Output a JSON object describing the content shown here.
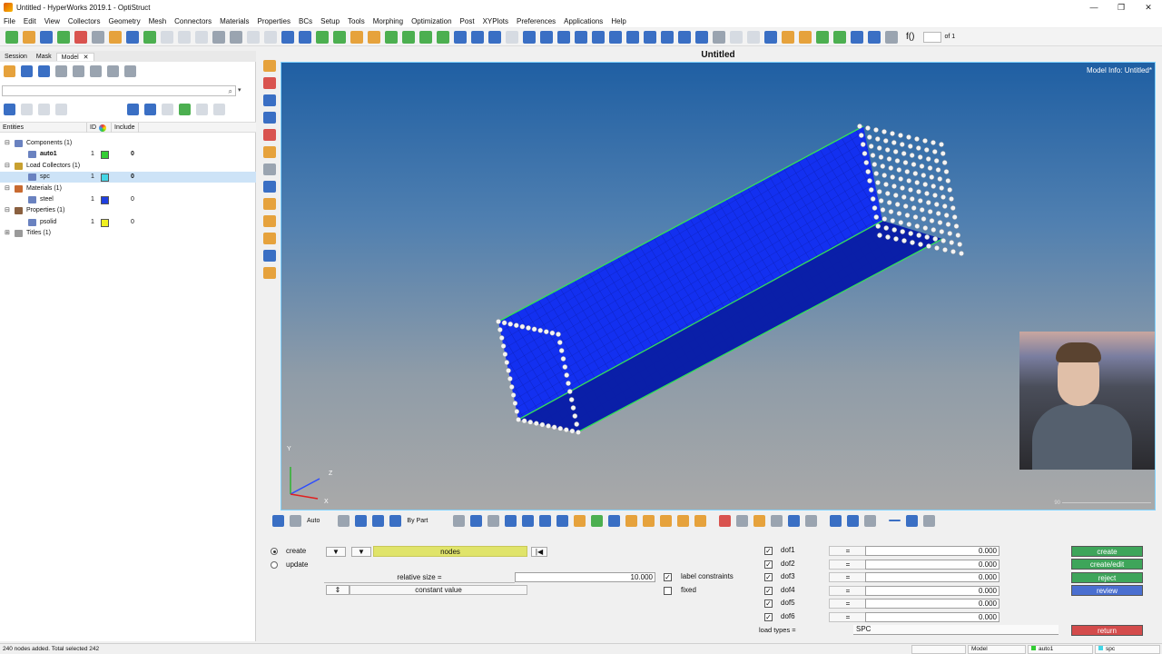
{
  "window": {
    "title": "Untitled - HyperWorks 2019.1 - OptiStruct",
    "controls": [
      "—",
      "❐",
      "✕"
    ]
  },
  "menu": [
    "File",
    "Edit",
    "View",
    "Collectors",
    "Geometry",
    "Mesh",
    "Connectors",
    "Materials",
    "Properties",
    "BCs",
    "Setup",
    "Tools",
    "Morphing",
    "Optimization",
    "Post",
    "XYPlots",
    "Preferences",
    "Applications",
    "Help"
  ],
  "toolbar": {
    "formula_label": "f()",
    "page_label": "of 1"
  },
  "left_panel": {
    "tabs": [
      "Session",
      "Mask",
      "Model"
    ],
    "close_glyph": "✕",
    "search_dropdown": "▾",
    "columns": {
      "entities": "Entities",
      "id": "ID",
      "include": "Include"
    },
    "tree": [
      {
        "name": "Components (1)",
        "level": 0,
        "expand": "⊟",
        "icon": "#6a82c0"
      },
      {
        "name": "auto1",
        "level": 1,
        "id": "1",
        "color": "#33cc33",
        "include": "0",
        "bold": true
      },
      {
        "name": "Load Collectors (1)",
        "level": 0,
        "expand": "⊟",
        "icon": "#c8a030"
      },
      {
        "name": "spc",
        "level": 1,
        "id": "1",
        "color": "#44d6e6",
        "include": "0",
        "selected": true
      },
      {
        "name": "Materials (1)",
        "level": 0,
        "expand": "⊟",
        "icon": "#c86a30"
      },
      {
        "name": "steel",
        "level": 1,
        "id": "1",
        "color": "#1f3fe0",
        "include": "0"
      },
      {
        "name": "Properties (1)",
        "level": 0,
        "expand": "⊟",
        "icon": "#8a6040"
      },
      {
        "name": "psolid",
        "level": 1,
        "id": "1",
        "color": "#f0f020",
        "include": "0"
      },
      {
        "name": "Titles (1)",
        "level": 0,
        "expand": "⊞",
        "icon": "#9a9a9a"
      }
    ]
  },
  "viewport": {
    "title": "Untitled",
    "model_info": "Model Info: Untitled*",
    "scale_label": "90",
    "axes": {
      "y": "Y",
      "z": "Z",
      "x": "X"
    }
  },
  "view_toolbar": {
    "auto_label": "Auto",
    "by_part_label": "By Part"
  },
  "panel": {
    "mode_create": "create",
    "mode_update": "update",
    "selector_label": "nodes",
    "relative_size_label": "relative size =",
    "relative_size_value": "10.000",
    "constant_value_label": "constant value",
    "label_constraints": "label constraints",
    "fixed_label": "fixed",
    "dofs": [
      {
        "name": "dof1",
        "checked": true,
        "value": "0.000"
      },
      {
        "name": "dof2",
        "checked": true,
        "value": "0.000"
      },
      {
        "name": "dof3",
        "checked": true,
        "value": "0.000"
      },
      {
        "name": "dof4",
        "checked": true,
        "value": "0.000"
      },
      {
        "name": "dof5",
        "checked": true,
        "value": "0.000"
      },
      {
        "name": "dof6",
        "checked": true,
        "value": "0.000"
      }
    ],
    "equals": "=",
    "load_types_label": "load types =",
    "load_types_value": "SPC",
    "buttons": {
      "create": "create",
      "create_edit": "create/edit",
      "reject": "reject",
      "review": "review",
      "return": "return"
    }
  },
  "statusbar": {
    "message": "240 nodes added. Total selected 242",
    "model": "Model",
    "component": "auto1",
    "collector": "spc"
  }
}
